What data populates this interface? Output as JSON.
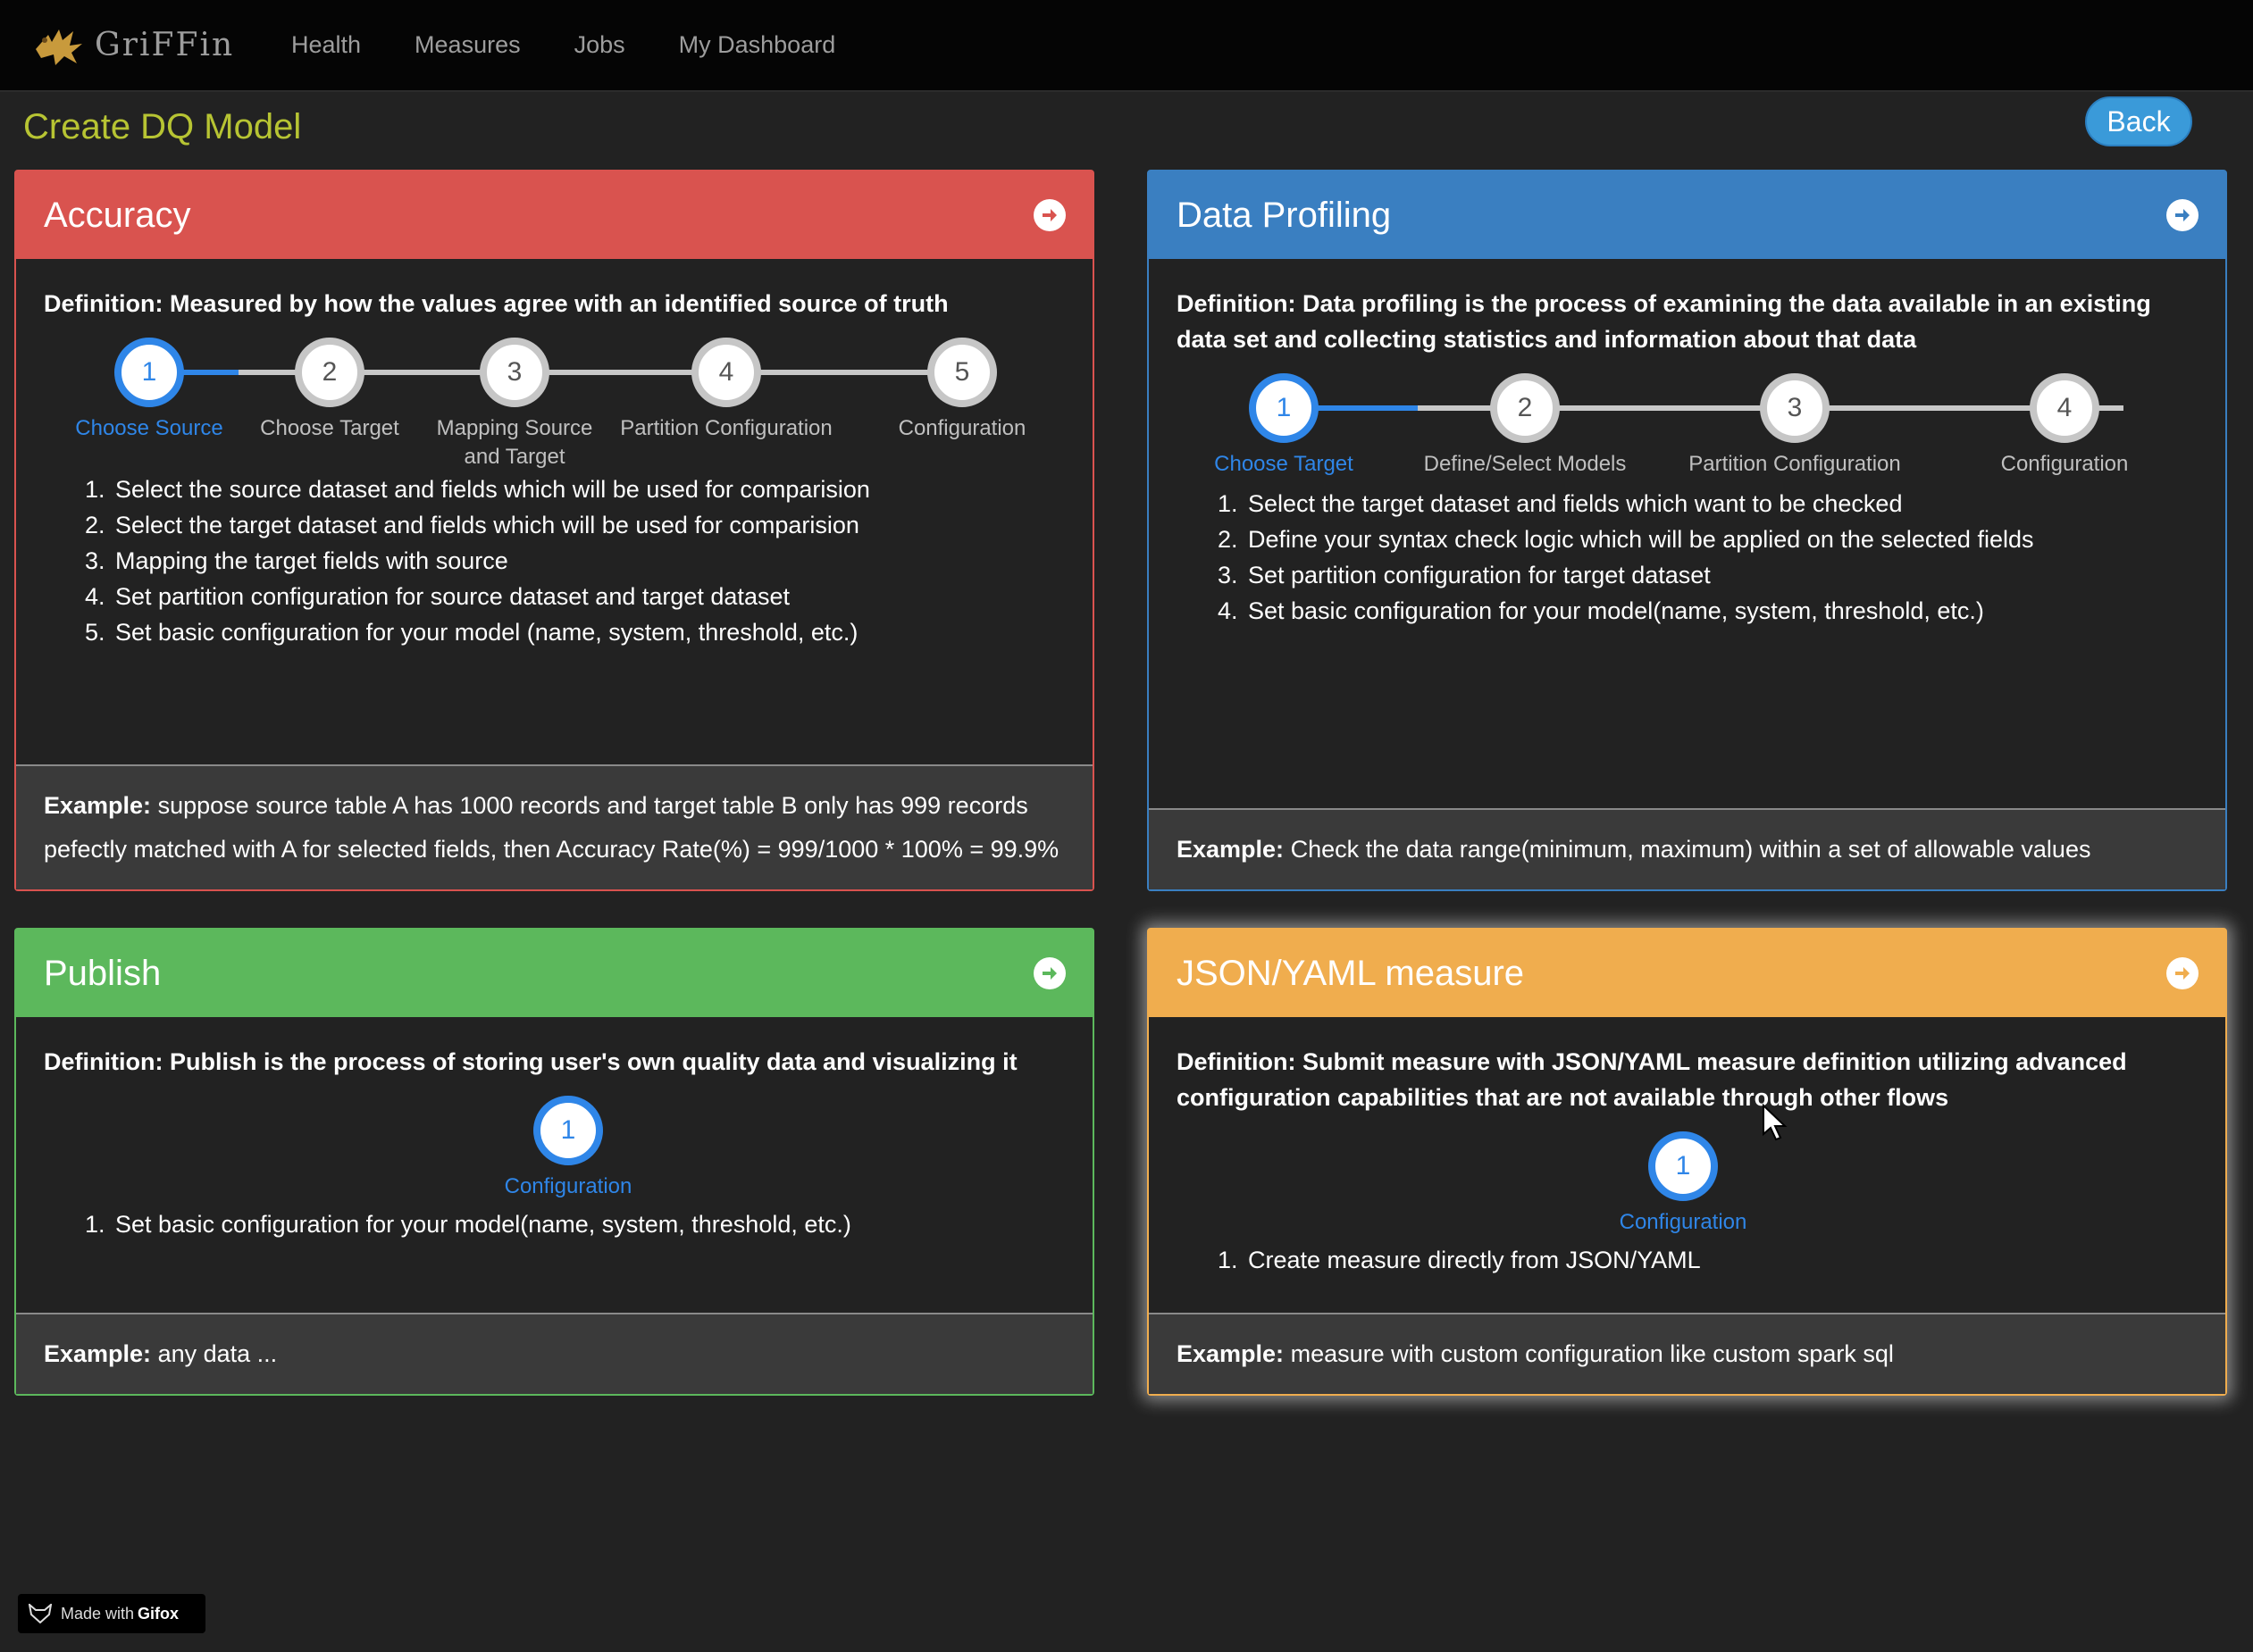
{
  "nav": {
    "brand": "GriFFin",
    "items": [
      "Health",
      "Measures",
      "Jobs",
      "My Dashboard"
    ]
  },
  "header": {
    "title": "Create DQ Model",
    "back_label": "Back"
  },
  "panels": {
    "accuracy": {
      "title": "Accuracy",
      "definition": "Definition: Measured by how the values agree with an identified source of truth",
      "steps": [
        {
          "num": "1",
          "label": "Choose Source"
        },
        {
          "num": "2",
          "label": "Choose Target"
        },
        {
          "num": "3",
          "label": "Mapping Source and Target"
        },
        {
          "num": "4",
          "label": "Partition Configuration"
        },
        {
          "num": "5",
          "label": "Configuration"
        }
      ],
      "items": [
        "Select the source dataset and fields which will be used for comparision",
        "Select the target dataset and fields which will be used for comparision",
        "Mapping the target fields with source",
        "Set partition configuration for source dataset and target dataset",
        "Set basic configuration for your model (name, system, threshold, etc.)"
      ],
      "example_label": "Example:",
      "example_text": "suppose source table A has 1000 records and target table B only has 999 records pefectly matched with A for selected fields, then Accuracy Rate(%) = 999/1000 * 100% = 99.9%"
    },
    "profiling": {
      "title": "Data Profiling",
      "definition": "Definition: Data profiling is the process of examining the data available in an existing data set and collecting statistics and information about that data",
      "steps": [
        {
          "num": "1",
          "label": "Choose Target"
        },
        {
          "num": "2",
          "label": "Define/Select Models"
        },
        {
          "num": "3",
          "label": "Partition Configuration"
        },
        {
          "num": "4",
          "label": "Configuration"
        }
      ],
      "items": [
        "Select the target dataset and fields which want to be checked",
        "Define your syntax check logic which will be applied on the selected fields",
        "Set partition configuration for target dataset",
        "Set basic configuration for your model(name, system, threshold, etc.)"
      ],
      "example_label": "Example:",
      "example_text": "Check the data range(minimum, maximum) within a set of allowable values"
    },
    "publish": {
      "title": "Publish",
      "definition": "Definition: Publish is the process of storing user's own quality data and visualizing it",
      "steps": [
        {
          "num": "1",
          "label": "Configuration"
        }
      ],
      "items": [
        "Set basic configuration for your model(name, system, threshold, etc.)"
      ],
      "example_label": "Example:",
      "example_text": "any data ..."
    },
    "json": {
      "title": "JSON/YAML measure",
      "definition": "Definition: Submit measure with JSON/YAML measure definition utilizing advanced configuration capabilities that are not available through other flows",
      "steps": [
        {
          "num": "1",
          "label": "Configuration"
        }
      ],
      "items": [
        "Create measure directly from JSON/YAML"
      ],
      "example_label": "Example:",
      "example_text": "measure with custom configuration like custom spark sql"
    }
  },
  "watermark": {
    "prefix": "Made with",
    "brand": "Gifox"
  },
  "colors": {
    "accuracy": "#d9534f",
    "profiling": "#3a7fc1",
    "publish": "#5cb85c",
    "json": "#f0ad4e",
    "step_active": "#2f86e8",
    "title": "#b7c433"
  }
}
